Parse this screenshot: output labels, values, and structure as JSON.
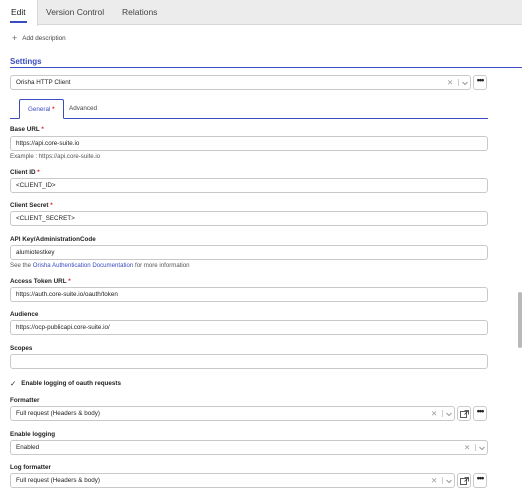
{
  "tabs": [
    "Edit",
    "Version Control",
    "Relations"
  ],
  "add_description": "Add description",
  "settings_title": "Settings",
  "client_select": {
    "value": "Orisha HTTP Client"
  },
  "subtabs": {
    "general": "General",
    "general_marker": "*",
    "advanced": "Advanced"
  },
  "required_marker": "*",
  "fields": {
    "base_url": {
      "label": "Base URL",
      "value": "https://api.core-suite.io",
      "help": "Example : https://api.core-suite.io"
    },
    "client_id": {
      "label": "Client ID",
      "value": "<CLIENT_ID>"
    },
    "client_secret": {
      "label": "Client Secret",
      "value": "<CLIENT_SECRET>"
    },
    "api_key": {
      "label": "API Key/AdministrationCode",
      "value": "alumiotestkey",
      "help_prefix": "See the ",
      "help_link": "Orisha Authentication Documentation",
      "help_suffix": " for more information"
    },
    "token_url": {
      "label": "Access Token URL",
      "value": "https://auth.core-suite.io/oauth/token"
    },
    "audience": {
      "label": "Audience",
      "value": "https://ocp-publicapi.core-suite.io/"
    },
    "scopes": {
      "label": "Scopes",
      "value": ""
    }
  },
  "oauth_logging": {
    "label": "Enable logging of oauth requests",
    "checked": true
  },
  "formatter": {
    "label": "Formatter",
    "value": "Full request (Headers & body)"
  },
  "enable_logging": {
    "label": "Enable logging",
    "value": "Enabled"
  },
  "log_formatter": {
    "label": "Log formatter",
    "value": "Full request (Headers & body)"
  }
}
